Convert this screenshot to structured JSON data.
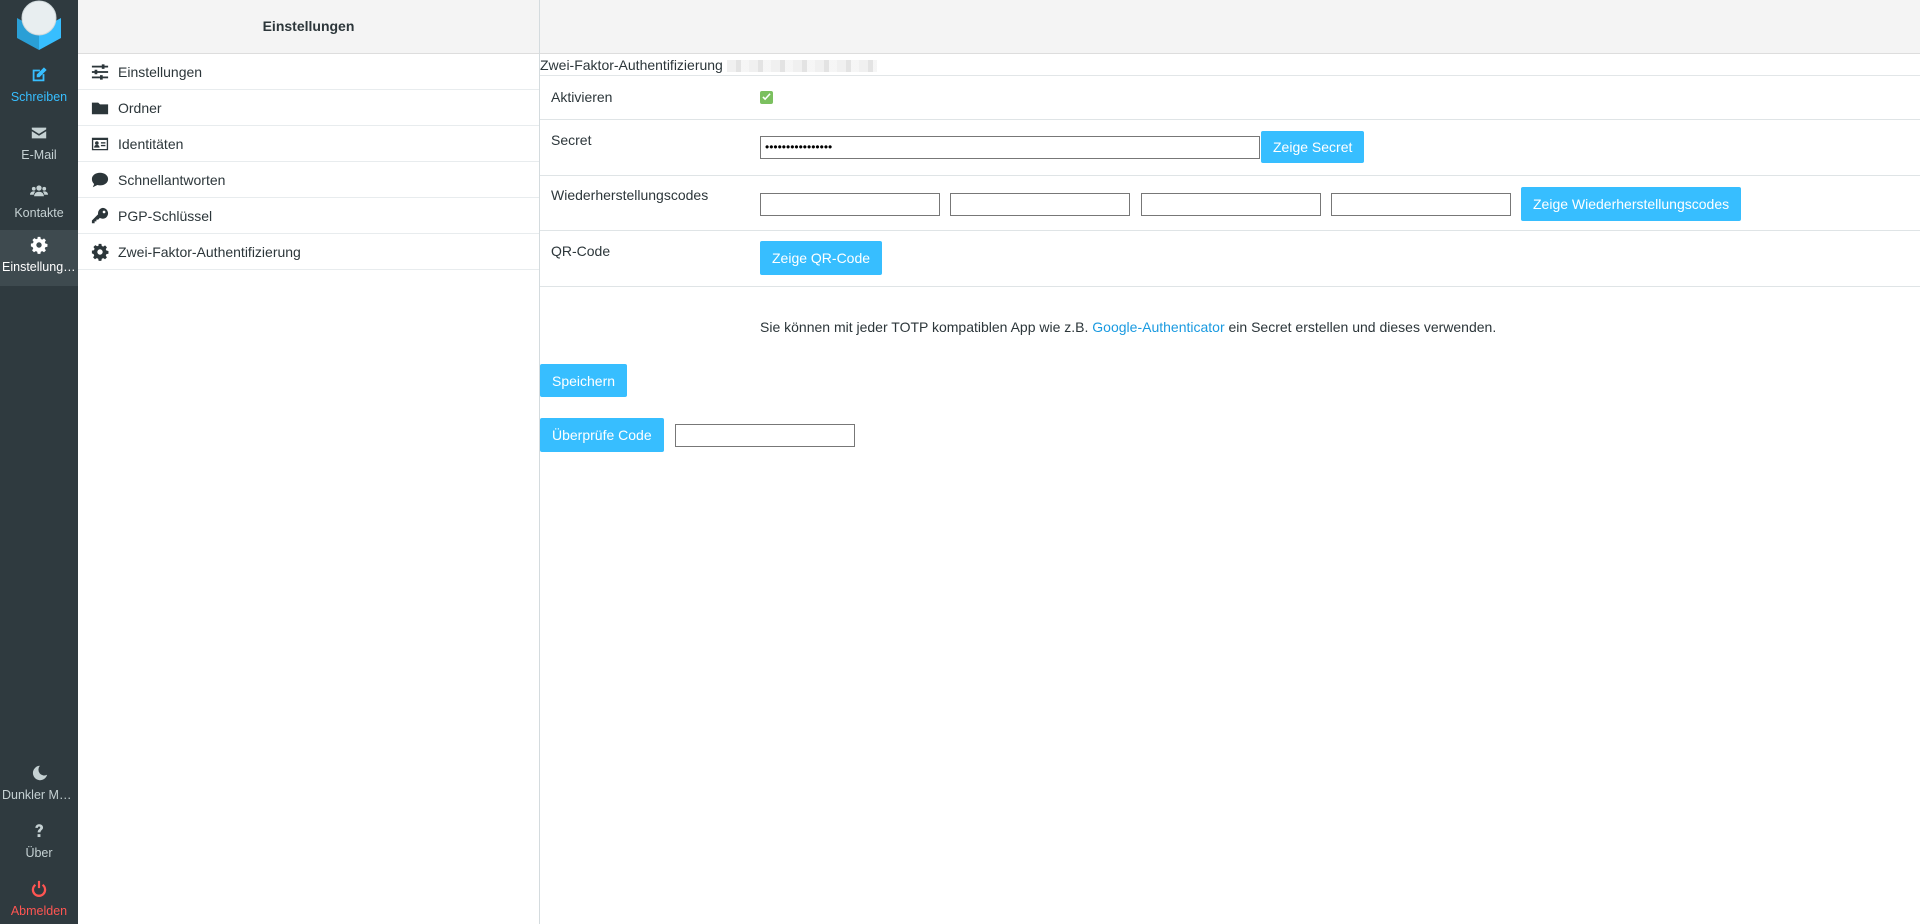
{
  "nav": {
    "items": [
      {
        "label": "Schreiben",
        "icon": "compose-icon"
      },
      {
        "label": "E-Mail",
        "icon": "envelope-icon"
      },
      {
        "label": "Kontakte",
        "icon": "users-icon"
      },
      {
        "label": "Einstellungen",
        "icon": "gear-icon"
      }
    ],
    "bottom": [
      {
        "label": "Dunkler Mo...",
        "icon": "moon-icon"
      },
      {
        "label": "Über",
        "icon": "question-icon"
      },
      {
        "label": "Abmelden",
        "icon": "power-icon"
      }
    ]
  },
  "sidebar": {
    "title": "Einstellungen",
    "items": [
      {
        "label": "Einstellungen",
        "icon": "sliders-icon"
      },
      {
        "label": "Ordner",
        "icon": "folder-icon"
      },
      {
        "label": "Identitäten",
        "icon": "id-card-icon"
      },
      {
        "label": "Schnellantworten",
        "icon": "comment-icon"
      },
      {
        "label": "PGP-Schlüssel",
        "icon": "key-icon"
      },
      {
        "label": "Zwei-Faktor-Authentifizierung",
        "icon": "gear-icon"
      }
    ]
  },
  "content": {
    "section_title": "Zwei-Faktor-Authentifizierung",
    "activate_label": "Aktivieren",
    "secret_label": "Secret",
    "secret_value": "••••••••••••••••",
    "show_secret": "Zeige Secret",
    "recovery_label": "Wiederherstellungscodes",
    "show_recovery": "Zeige Wiederherstellungscodes",
    "qr_label": "QR-Code",
    "show_qr": "Zeige QR-Code",
    "info_before": "Sie können mit jeder TOTP kompatiblen App wie z.B. ",
    "info_link": "Google-Authenticator",
    "info_after": " ein Secret erstellen und dieses verwenden.",
    "save": "Speichern",
    "verify": "Überprüfe Code"
  },
  "colors": {
    "accent": "#37beff",
    "nav_bg": "#2f3a3f",
    "logout": "#ff5552",
    "check": "#7bc05f"
  }
}
